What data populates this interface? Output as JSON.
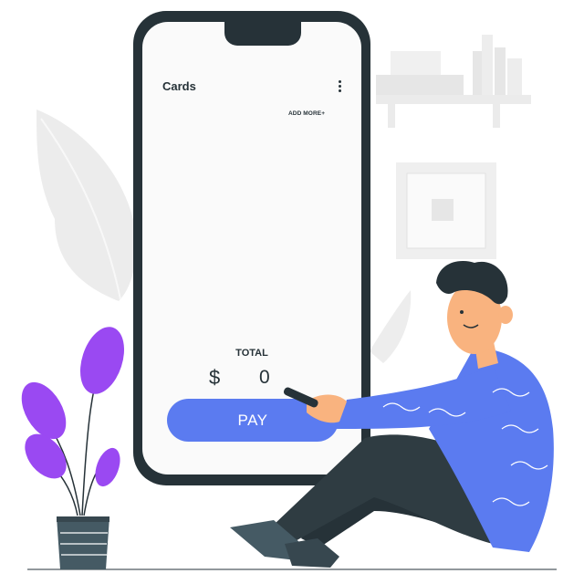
{
  "phone_screen": {
    "title": "Cards",
    "add_more": "ADD MORE+",
    "total_label": "TOTAL",
    "currency": "$",
    "amount": "0",
    "pay_button": "PAY"
  },
  "colors": {
    "phone_frame": "#263238",
    "screen_bg": "#fafafa",
    "accent": "#5b7bf0",
    "sweater": "#5b7bf0",
    "leaves": "#9a49f2",
    "skin": "#f9b37f",
    "background_shapes": "#ebebeb"
  },
  "icons": [
    "kebab-menu-icon",
    "plant-icon",
    "shelf-icon",
    "picture-frame-icon",
    "leaf-icon"
  ]
}
